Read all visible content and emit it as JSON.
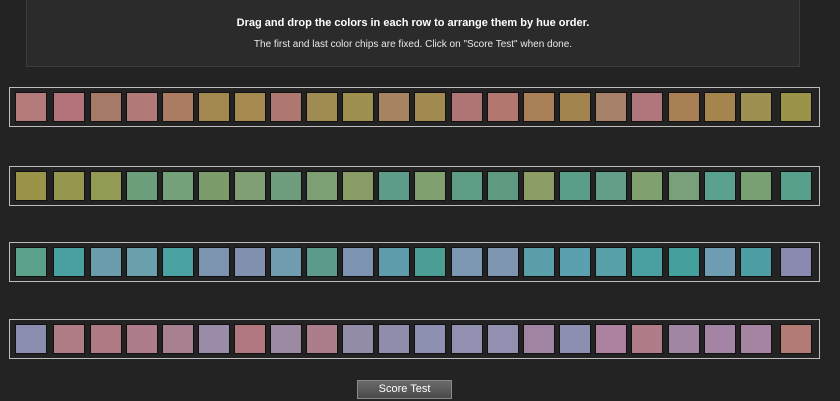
{
  "instructions": {
    "title": "Drag and drop the colors in each row to arrange them by hue order.",
    "subtitle": "The first and last color chips are fixed. Click on \"Score Test\" when done."
  },
  "rows": [
    {
      "name": "row-1",
      "chips": [
        "#b47a7c",
        "#b2747a",
        "#a67a66",
        "#b07a78",
        "#ac7c62",
        "#a2884e",
        "#a78a50",
        "#ac7870",
        "#a08c50",
        "#a09050",
        "#a68462",
        "#a08a50",
        "#ae7476",
        "#b2776e",
        "#aa8058",
        "#a28450",
        "#a68068",
        "#b0767c",
        "#a88054",
        "#a6844e",
        "#9e9050",
        "#9a9448"
      ]
    },
    {
      "name": "row-2",
      "chips": [
        "#999448",
        "#96974f",
        "#929a54",
        "#6c9e7c",
        "#74a07a",
        "#7c9c6c",
        "#80a074",
        "#6e9c7c",
        "#7ca074",
        "#8a9c66",
        "#5c9c88",
        "#80a070",
        "#5e9e84",
        "#5e9a80",
        "#8c9e66",
        "#5a9e8a",
        "#629e88",
        "#80a070",
        "#78a07a",
        "#5aa08e",
        "#78a072",
        "#56a08c"
      ]
    },
    {
      "name": "row-3",
      "chips": [
        "#5aa08a",
        "#4aa0a0",
        "#6a9cac",
        "#6aa0ac",
        "#4aa2a2",
        "#7c94b0",
        "#8090ae",
        "#709cb0",
        "#5c9a8c",
        "#7c94b2",
        "#5e9cac",
        "#4c9e94",
        "#7c98b2",
        "#7e96b2",
        "#5a9eaa",
        "#5aa0ae",
        "#58a0a8",
        "#4aa0a0",
        "#44a09c",
        "#6e9cb2",
        "#4c9ea2",
        "#8a8ab0"
      ]
    },
    {
      "name": "row-4",
      "chips": [
        "#8a8cb0",
        "#b07c86",
        "#b07a84",
        "#ae7c8a",
        "#a88092",
        "#9a8ca8",
        "#b0787e",
        "#9c8aa2",
        "#ac7e8c",
        "#928ca8",
        "#908cac",
        "#8e90b2",
        "#9290b0",
        "#9290b0",
        "#a084a2",
        "#8c8eb2",
        "#ac82a0",
        "#b07c88",
        "#a086a2",
        "#a484a4",
        "#a484a0",
        "#b07c74"
      ]
    }
  ],
  "score_button": {
    "label": "Score Test"
  }
}
